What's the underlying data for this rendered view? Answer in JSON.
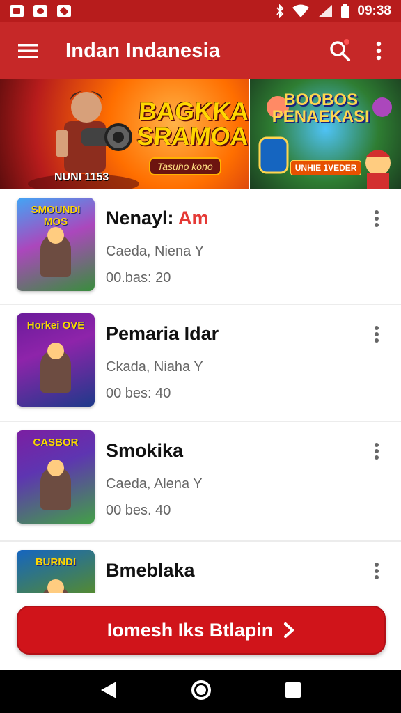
{
  "status_bar": {
    "time": "09:38",
    "icons": [
      "image-icon",
      "notification-icon",
      "flipboard-icon",
      "bluetooth-icon",
      "wifi-icon",
      "signal-icon",
      "battery-icon"
    ]
  },
  "app_bar": {
    "title": "Indan Indanesia",
    "menu_icon": "hamburger-menu-icon",
    "search_icon": "search-icon",
    "more_icon": "more-vertical-icon",
    "accent_color": "#c62828"
  },
  "banners": [
    {
      "title_line1": "BAGKKA",
      "title_line2": "SRAMOAN",
      "subtitle": "Tasuho kono",
      "tag": "NUNI 1153"
    },
    {
      "title_line1": "BOOBOS",
      "title_line2": "PENAEKASI",
      "subtitle": "UNHIE 1VEDER"
    }
  ],
  "games": [
    {
      "name": "Nenayl: ",
      "name_accent": "Am",
      "meta": "Caeda, Niena  Y",
      "stats": "00.bas: 20",
      "thumb_title": "SMOUNDI MOS"
    },
    {
      "name": "Pemaria Idar",
      "name_accent": "",
      "meta": "Ckada, Niaha  Y",
      "stats": "00 bes: 40",
      "thumb_title": "Horkei OVE"
    },
    {
      "name": "Smokika",
      "name_accent": "",
      "meta": "Caeda, Alena  Y",
      "stats": "00 bes. 40",
      "thumb_title": "CASBOR"
    },
    {
      "name": "Bmeblaka",
      "name_accent": "",
      "meta": "",
      "stats": "",
      "thumb_title": "BURNDI"
    }
  ],
  "cta": {
    "label": "Iomesh Iks Btlapin",
    "arrow": "chevron-right-icon",
    "color": "#d0141a"
  },
  "nav_bar": {
    "back": "back-triangle-icon",
    "home": "home-circle-icon",
    "recents": "recents-square-icon"
  }
}
